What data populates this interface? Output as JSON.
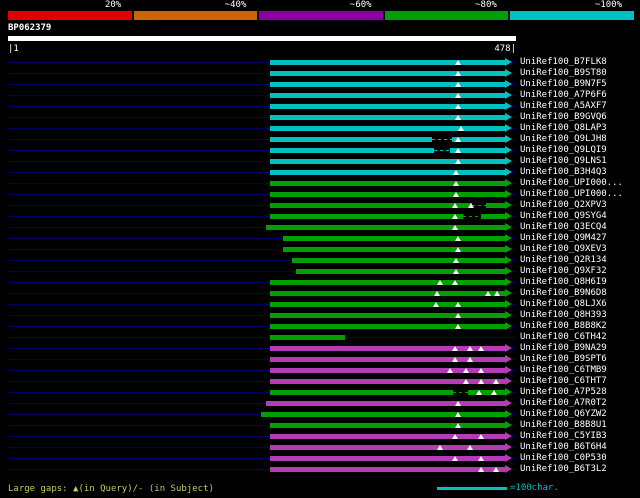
{
  "chart_data": {
    "type": "bar",
    "orientation": "horizontal",
    "title": "BP062379",
    "x_axis": {
      "min": 1,
      "max": 478
    },
    "identity_scale": [
      "20%",
      "~40%",
      "~60%",
      "~80%",
      "~100%"
    ],
    "identity_colors": [
      "#e00000",
      "#cc6600",
      "#8a00a0",
      "#00a000",
      "#00c0c0"
    ],
    "bar_colors": {
      "cyan": "#00c0c0",
      "green": "#00a000",
      "magenta": "#b43cb4"
    },
    "hits": [
      {
        "label": "UniRef100_B7FLK8",
        "color": "cyan",
        "q_start": 247,
        "q_end": 468,
        "query_gaps": [
          424
        ],
        "subject_gaps": []
      },
      {
        "label": "UniRef100_B9ST80",
        "color": "cyan",
        "q_start": 247,
        "q_end": 468,
        "query_gaps": [
          424
        ],
        "subject_gaps": []
      },
      {
        "label": "UniRef100_B9N7F5",
        "color": "cyan",
        "q_start": 247,
        "q_end": 468,
        "query_gaps": [
          424
        ],
        "subject_gaps": []
      },
      {
        "label": "UniRef100_A7P6F6",
        "color": "cyan",
        "q_start": 247,
        "q_end": 468,
        "query_gaps": [
          424
        ],
        "subject_gaps": []
      },
      {
        "label": "UniRef100_A5AXF7",
        "color": "cyan",
        "q_start": 247,
        "q_end": 468,
        "query_gaps": [
          424
        ],
        "subject_gaps": []
      },
      {
        "label": "UniRef100_B9GVQ6",
        "color": "cyan",
        "q_start": 247,
        "q_end": 468,
        "query_gaps": [
          424
        ],
        "subject_gaps": []
      },
      {
        "label": "UniRef100_Q8LAP3",
        "color": "cyan",
        "q_start": 247,
        "q_end": 468,
        "query_gaps": [
          426
        ],
        "subject_gaps": []
      },
      {
        "label": "UniRef100_Q9LJH8",
        "color": "cyan",
        "q_start": 247,
        "q_end": 468,
        "query_gaps": [
          424
        ],
        "subject_gaps": [
          [
            399,
            418
          ]
        ]
      },
      {
        "label": "UniRef100_Q9LQI9",
        "color": "cyan",
        "q_start": 247,
        "q_end": 468,
        "query_gaps": [
          424
        ],
        "subject_gaps": [
          [
            401,
            416
          ]
        ]
      },
      {
        "label": "UniRef100_Q9LNS1",
        "color": "cyan",
        "q_start": 247,
        "q_end": 468,
        "query_gaps": [
          424
        ],
        "subject_gaps": []
      },
      {
        "label": "UniRef100_B3H4Q3",
        "color": "cyan",
        "q_start": 247,
        "q_end": 468,
        "query_gaps": [
          422
        ],
        "subject_gaps": []
      },
      {
        "label": "UniRef100_UPI000...",
        "color": "green",
        "q_start": 247,
        "q_end": 468,
        "query_gaps": [
          422
        ],
        "subject_gaps": []
      },
      {
        "label": "UniRef100_UPI000...",
        "color": "green",
        "q_start": 247,
        "q_end": 468,
        "query_gaps": [
          422
        ],
        "subject_gaps": []
      },
      {
        "label": "UniRef100_Q2XPV3",
        "color": "green",
        "q_start": 247,
        "q_end": 468,
        "query_gaps": [
          421,
          436
        ],
        "subject_gaps": [
          [
            437,
            450
          ]
        ]
      },
      {
        "label": "UniRef100_Q9SYG4",
        "color": "green",
        "q_start": 247,
        "q_end": 468,
        "query_gaps": [
          421
        ],
        "subject_gaps": [
          [
            428,
            445
          ]
        ]
      },
      {
        "label": "UniRef100_Q3ECQ4",
        "color": "green",
        "q_start": 243,
        "q_end": 468,
        "query_gaps": [
          421
        ],
        "subject_gaps": []
      },
      {
        "label": "UniRef100_Q9M427",
        "color": "green",
        "q_start": 259,
        "q_end": 468,
        "query_gaps": [
          424
        ],
        "subject_gaps": []
      },
      {
        "label": "UniRef100_Q9XEV3",
        "color": "green",
        "q_start": 259,
        "q_end": 468,
        "query_gaps": [
          424
        ],
        "subject_gaps": []
      },
      {
        "label": "UniRef100_Q2R134",
        "color": "green",
        "q_start": 268,
        "q_end": 468,
        "query_gaps": [
          422
        ],
        "subject_gaps": []
      },
      {
        "label": "UniRef100_Q9XF32",
        "color": "green",
        "q_start": 271,
        "q_end": 468,
        "query_gaps": [
          422
        ],
        "subject_gaps": []
      },
      {
        "label": "UniRef100_Q8H6I9",
        "color": "green",
        "q_start": 247,
        "q_end": 468,
        "query_gaps": [
          407,
          421
        ],
        "subject_gaps": []
      },
      {
        "label": "UniRef100_B9N6D8",
        "color": "green",
        "q_start": 247,
        "q_end": 468,
        "query_gaps": [
          404,
          452,
          460
        ],
        "subject_gaps": []
      },
      {
        "label": "UniRef100_Q8LJX6",
        "color": "green",
        "q_start": 247,
        "q_end": 468,
        "query_gaps": [
          403,
          424
        ],
        "subject_gaps": []
      },
      {
        "label": "UniRef100_Q8H393",
        "color": "green",
        "q_start": 247,
        "q_end": 468,
        "query_gaps": [
          424
        ],
        "subject_gaps": []
      },
      {
        "label": "UniRef100_B8B8K2",
        "color": "green",
        "q_start": 247,
        "q_end": 468,
        "query_gaps": [
          424
        ],
        "subject_gaps": []
      },
      {
        "label": "UniRef100_C6TH42",
        "color": "green",
        "q_start": 247,
        "q_end": 317,
        "arrow": false,
        "query_gaps": [],
        "subject_gaps": []
      },
      {
        "label": "UniRef100_B9NA29",
        "color": "magenta",
        "q_start": 247,
        "q_end": 468,
        "query_gaps": [
          421,
          435,
          445
        ],
        "subject_gaps": []
      },
      {
        "label": "UniRef100_B9SPT6",
        "color": "magenta",
        "q_start": 247,
        "q_end": 468,
        "query_gaps": [
          421,
          435
        ],
        "subject_gaps": []
      },
      {
        "label": "UniRef100_C6TMB9",
        "color": "magenta",
        "q_start": 247,
        "q_end": 468,
        "query_gaps": [
          416,
          431,
          445
        ],
        "subject_gaps": []
      },
      {
        "label": "UniRef100_C6THT7",
        "color": "magenta",
        "q_start": 247,
        "q_end": 468,
        "query_gaps": [
          431,
          445,
          459
        ],
        "subject_gaps": []
      },
      {
        "label": "UniRef100_A7P528",
        "color": "green",
        "q_start": 247,
        "q_end": 468,
        "query_gaps": [
          443,
          457
        ],
        "subject_gaps": [
          [
            419,
            433
          ]
        ]
      },
      {
        "label": "UniRef100_A7R0T2",
        "color": "magenta",
        "q_start": 243,
        "q_end": 468,
        "query_gaps": [
          424
        ],
        "subject_gaps": []
      },
      {
        "label": "UniRef100_Q6YZW2",
        "color": "green",
        "q_start": 239,
        "q_end": 468,
        "query_gaps": [
          424
        ],
        "subject_gaps": []
      },
      {
        "label": "UniRef100_B8B8U1",
        "color": "green",
        "q_start": 247,
        "q_end": 468,
        "query_gaps": [
          424
        ],
        "subject_gaps": []
      },
      {
        "label": "UniRef100_C5YIB3",
        "color": "magenta",
        "q_start": 247,
        "q_end": 468,
        "query_gaps": [
          421,
          445
        ],
        "subject_gaps": []
      },
      {
        "label": "UniRef100_B6T6H4",
        "color": "magenta",
        "q_start": 247,
        "q_end": 468,
        "query_gaps": [
          407,
          435
        ],
        "subject_gaps": []
      },
      {
        "label": "UniRef100_C0P530",
        "color": "magenta",
        "q_start": 247,
        "q_end": 468,
        "query_gaps": [
          421,
          445
        ],
        "subject_gaps": []
      },
      {
        "label": "UniRef100_B6T3L2",
        "color": "magenta",
        "q_start": 247,
        "q_end": 468,
        "query_gaps": [
          445,
          459
        ],
        "subject_gaps": []
      }
    ]
  },
  "query": {
    "name": "BP062379",
    "ruler_left": "|1",
    "ruler_right": "478|"
  },
  "footer": {
    "gap_legend": "Large gaps: ▲(in Query)/- (in Subject)",
    "scale_line_legend": "=100char."
  }
}
